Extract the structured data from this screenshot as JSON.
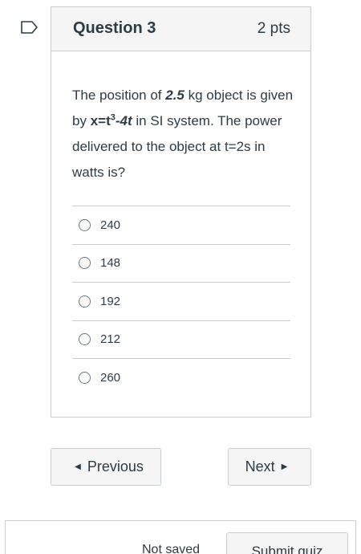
{
  "question": {
    "title": "Question 3",
    "points": "2 pts",
    "text": {
      "part1": "The position of ",
      "mass": "2.5",
      "part2": " kg object is given by ",
      "eq_base": "x=t",
      "eq_exp": "3",
      "eq_tail": "-4t",
      "part3": " in SI system. The power delivered to the object at t=2s in watts is?"
    },
    "answers": [
      "240",
      "148",
      "192",
      "212",
      "260"
    ]
  },
  "navigation": {
    "previous_label": "Previous",
    "next_label": "Next",
    "prev_icon": "triangle-left-icon",
    "next_icon": "triangle-right-icon"
  },
  "footer": {
    "status": "Not saved",
    "submit_label": "Submit quiz"
  },
  "colors": {
    "text": "#2d3b45",
    "border": "#c7cdd1",
    "header_bg": "#f5f5f5"
  }
}
